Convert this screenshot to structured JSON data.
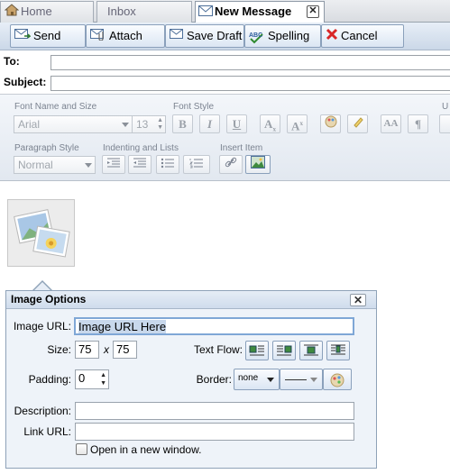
{
  "tabs": [
    {
      "label": "Home",
      "icon": "home-icon"
    },
    {
      "label": "Inbox"
    },
    {
      "label": "New Message",
      "icon": "envelope-icon",
      "active": true,
      "close": "✕"
    }
  ],
  "toolbar": {
    "send": "Send",
    "attach": "Attach",
    "save_draft": "Save Draft",
    "spelling": "Spelling",
    "cancel": "Cancel",
    "spell_icon_text": "ABC"
  },
  "compose": {
    "to_label": "To:",
    "subject_label": "Subject:",
    "to_value": "",
    "subject_value": ""
  },
  "format_toolbar": {
    "font_name_size_label": "Font Name and Size",
    "font_name": "Arial",
    "font_size": "13",
    "font_style_label": "Font Style",
    "bold": "B",
    "italic": "I",
    "underline": "U",
    "subscript": "A",
    "superscript": "A",
    "paragraph_mark": "¶",
    "paragraph_style_label": "Paragraph Style",
    "paragraph_style": "Normal",
    "indenting_label": "Indenting and Lists",
    "insert_label": "Insert Item",
    "overflow_label": "U"
  },
  "image_options": {
    "title": "Image Options",
    "close": "✕",
    "url_label": "Image URL:",
    "url_value": "Image URL Here",
    "size_label": "Size:",
    "width": "75",
    "times": "x",
    "height": "75",
    "text_flow_label": "Text Flow:",
    "padding_label": "Padding:",
    "padding_value": "0",
    "border_label": "Border:",
    "border_style": "none",
    "description_label": "Description:",
    "description_value": "",
    "link_label": "Link URL:",
    "link_value": "",
    "new_window_label": "Open in a new window.",
    "new_window_checked": false
  },
  "colors": {
    "cancel_x": "#d92626",
    "accent_border": "#8aa0bb",
    "focus_border": "#7fa7d6"
  }
}
